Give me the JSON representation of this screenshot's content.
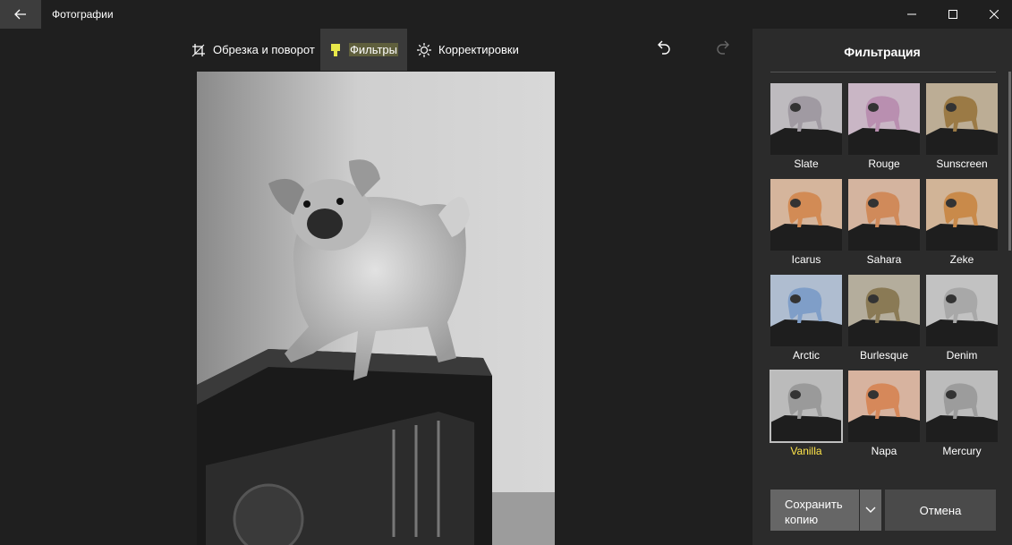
{
  "app": {
    "title": "Фотографии"
  },
  "toolbar": {
    "crop_label": "Обрезка и поворот",
    "filters_label": "Фильтры",
    "adjust_label": "Корректировки"
  },
  "panel": {
    "title": "Фильтрация",
    "filters": [
      {
        "name": "Slate",
        "tint": "#a09aa2"
      },
      {
        "name": "Rouge",
        "tint": "#b98fb0"
      },
      {
        "name": "Sunscreen",
        "tint": "#9b7a45"
      },
      {
        "name": "Icarus",
        "tint": "#d28b55"
      },
      {
        "name": "Sahara",
        "tint": "#d08a5a"
      },
      {
        "name": "Zeke",
        "tint": "#c98a4a"
      },
      {
        "name": "Arctic",
        "tint": "#7f9ec8"
      },
      {
        "name": "Burlesque",
        "tint": "#8a7a55"
      },
      {
        "name": "Denim",
        "tint": "#a8a8a8"
      },
      {
        "name": "Vanilla",
        "tint": "#9a9a9a",
        "selected": true
      },
      {
        "name": "Napa",
        "tint": "#d6885a"
      },
      {
        "name": "Mercury",
        "tint": "#9c9c9c"
      }
    ],
    "save_label_line1": "Сохранить",
    "save_label_line2": "копию",
    "cancel_label": "Отмена"
  },
  "colors": {
    "highlight": "#ffe54a",
    "panel_bg": "#2b2b2b",
    "app_bg": "#1f1f1f"
  }
}
